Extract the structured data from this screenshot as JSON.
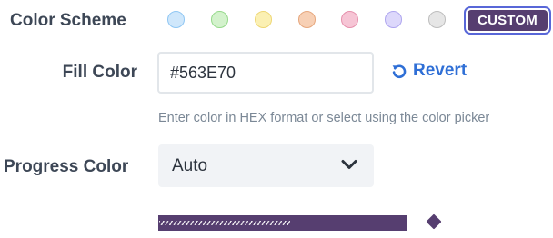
{
  "color_scheme": {
    "label": "Color Scheme",
    "swatches": [
      {
        "fill": "#cfe7fb",
        "border": "#8ec6f3"
      },
      {
        "fill": "#d3f2cc",
        "border": "#95d98a"
      },
      {
        "fill": "#fbf0b3",
        "border": "#eed774"
      },
      {
        "fill": "#f7d0b5",
        "border": "#e6a67c"
      },
      {
        "fill": "#f6c5d5",
        "border": "#e691ad"
      },
      {
        "fill": "#ddd8fb",
        "border": "#aea5ef"
      },
      {
        "fill": "#e6e6e6",
        "border": "#bdbdbd"
      }
    ],
    "custom_label": "CUSTOM",
    "custom_color": "#563e70",
    "selected": "custom"
  },
  "fill_color": {
    "label": "Fill Color",
    "value": "#563E70",
    "revert_label": "Revert",
    "help_text": "Enter color in HEX format or select using the color picker"
  },
  "progress_color": {
    "label": "Progress Color",
    "value": "Auto"
  },
  "preview": {
    "color": "#563e70",
    "progress_fraction": 0.53
  }
}
